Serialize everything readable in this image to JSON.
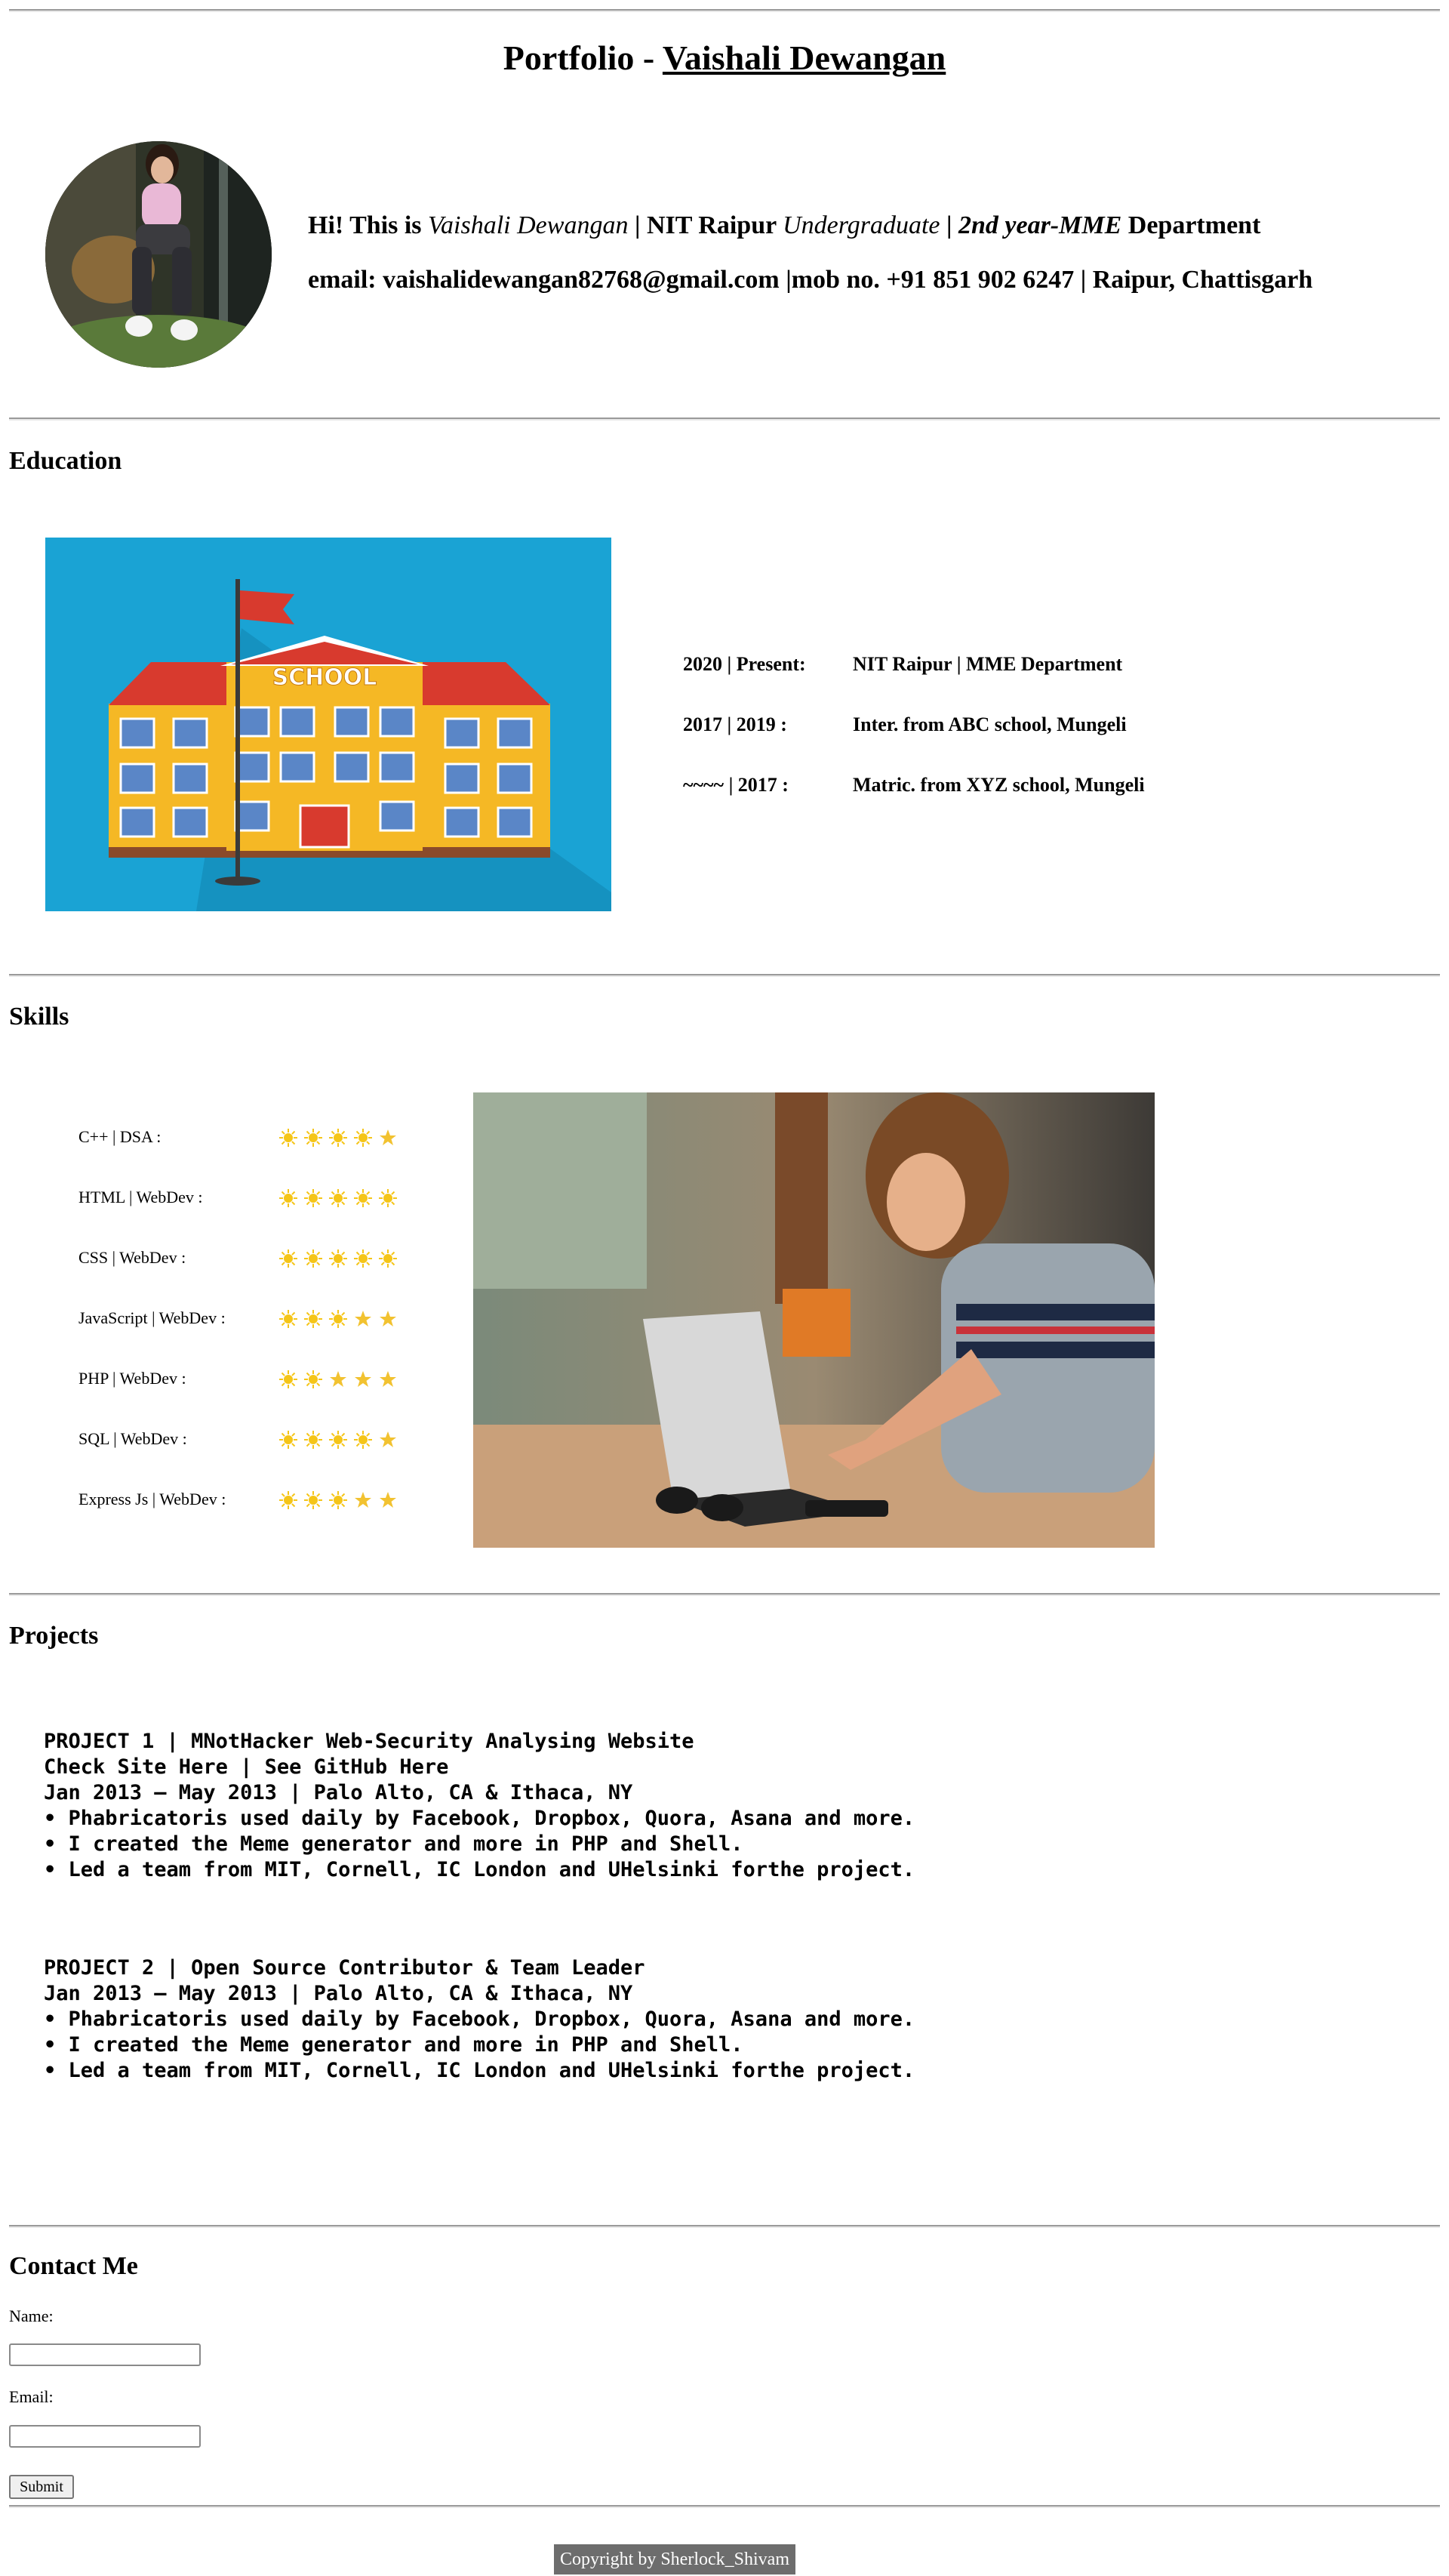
{
  "header": {
    "title_prefix": "Portfolio - ",
    "title_name": "Vaishali Dewangan",
    "intro": {
      "hi": "Hi! This is ",
      "name": "Vaishali Dewangan",
      "sep1": " | NIT Raipur ",
      "undergrad": "Undergraduate",
      "sep2": " | ",
      "year": "2nd year-MME",
      "dept": " Department"
    },
    "contact_line": "email: vaishalidewangan82768@gmail.com |mob no. +91 851 902 6247 | Raipur, Chattisgarh"
  },
  "education": {
    "heading": "Education",
    "image_text": "SCHOOL",
    "rows": [
      {
        "date": "2020 | Present:",
        "detail": "NIT Raipur | MME Department"
      },
      {
        "date": "2017 | 2019 :",
        "detail": "Inter. from ABC school, Mungeli"
      },
      {
        "date": "~~~~ | 2017 :",
        "detail": "Matric. from XYZ school, Mungeli"
      }
    ]
  },
  "skills": {
    "heading": "Skills",
    "items": [
      {
        "label": "C++ | DSA :",
        "stars": [
          "sun",
          "sun",
          "sun",
          "sun",
          "star"
        ]
      },
      {
        "label": "HTML | WebDev :",
        "stars": [
          "sun",
          "sun",
          "sun",
          "sun",
          "sun"
        ]
      },
      {
        "label": "CSS | WebDev :",
        "stars": [
          "sun",
          "sun",
          "sun",
          "sun",
          "sun"
        ]
      },
      {
        "label": "JavaScript | WebDev :",
        "stars": [
          "sun",
          "sun",
          "sun",
          "star",
          "star"
        ]
      },
      {
        "label": "PHP | WebDev :",
        "stars": [
          "sun",
          "sun",
          "star",
          "star",
          "star"
        ]
      },
      {
        "label": "SQL | WebDev :",
        "stars": [
          "sun",
          "sun",
          "sun",
          "sun",
          "star"
        ]
      },
      {
        "label": "Express Js | WebDev :",
        "stars": [
          "sun",
          "sun",
          "sun",
          "star",
          "star"
        ]
      }
    ]
  },
  "projects": {
    "heading": "Projects",
    "project1": [
      "PROJECT 1 | MNotHacker Web-Security Analysing Website",
      "Check Site Here | See GitHub Here",
      "Jan 2013 – May 2013 | Palo Alto, CA & Ithaca, NY",
      "• Phabricatoris used daily by Facebook, Dropbox, Quora, Asana and more.",
      "• I created the Meme generator and more in PHP and Shell.",
      "• Led a team from MIT, Cornell, IC London and UHelsinki forthe project."
    ],
    "project2": [
      "PROJECT 2 | Open Source Contributor & Team Leader",
      "Jan 2013 – May 2013 | Palo Alto, CA & Ithaca, NY",
      "• Phabricatoris used daily by Facebook, Dropbox, Quora, Asana and more.",
      "• I created the Meme generator and more in PHP and Shell.",
      "• Led a team from MIT, Cornell, IC London and UHelsinki forthe project."
    ]
  },
  "contact": {
    "heading": "Contact Me",
    "name_label": "Name:",
    "email_label": "Email:",
    "submit_label": "Submit"
  },
  "footer": {
    "copyright": "Copyright by Sherlock_Shivam"
  },
  "colors": {
    "sun": "#f5c518",
    "star": "#f2c230",
    "school_bg": "#1aa3d4",
    "footer_bg": "#6d6d6d"
  }
}
